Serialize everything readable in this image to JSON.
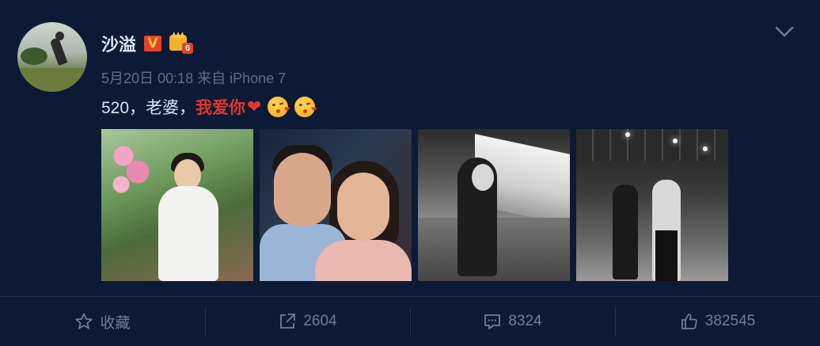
{
  "user": {
    "name": "沙溢",
    "verified_badge": "V",
    "level_badge_number": "6",
    "avatar_alt": "avatar"
  },
  "post": {
    "time": "5月20日 00:18",
    "source_prefix": "来自",
    "source": "iPhone 7",
    "text_plain": "520，老婆，",
    "text_highlight": "我爱你",
    "heart": "❤",
    "emojis": [
      "kiss-emoji",
      "kiss-emoji"
    ]
  },
  "photos": [
    {
      "name": "photo-woman-in-garden"
    },
    {
      "name": "photo-couple-selfie"
    },
    {
      "name": "photo-woman-at-train-platform"
    },
    {
      "name": "photo-couple-holding-hands"
    }
  ],
  "actions": {
    "favorite": {
      "icon": "star-icon",
      "label": "收藏"
    },
    "repost": {
      "icon": "share-icon",
      "count": "2604"
    },
    "comment": {
      "icon": "comment-icon",
      "count": "8324"
    },
    "like": {
      "icon": "thumbs-up-icon",
      "count": "382545"
    }
  },
  "colors": {
    "background": "#0c1a35",
    "name": "#dbe3f2",
    "meta": "#5d6e8f",
    "highlight": "#e3352d",
    "action_text": "#6d7d9c"
  }
}
